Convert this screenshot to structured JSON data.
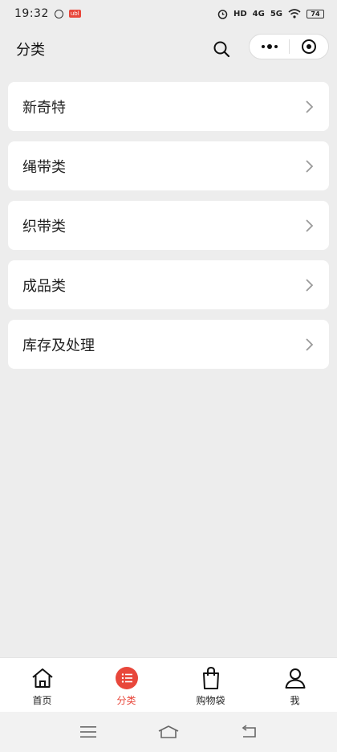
{
  "status_bar": {
    "time": "19:32",
    "red_badge": "ubl",
    "hd_label": "HD",
    "net1": "4G",
    "net2": "5G",
    "battery": "74"
  },
  "nav": {
    "title": "分类"
  },
  "categories": [
    {
      "label": "新奇特"
    },
    {
      "label": "绳带类"
    },
    {
      "label": "织带类"
    },
    {
      "label": "成品类"
    },
    {
      "label": "库存及处理"
    }
  ],
  "tabs": [
    {
      "label": "首页",
      "icon": "home-icon",
      "active": false
    },
    {
      "label": "分类",
      "icon": "list-icon",
      "active": true
    },
    {
      "label": "购物袋",
      "icon": "shopping-bag-icon",
      "active": false
    },
    {
      "label": "我",
      "icon": "person-icon",
      "active": false
    }
  ],
  "colors": {
    "accent": "#e8473b",
    "background": "#ededed",
    "card": "#ffffff"
  }
}
